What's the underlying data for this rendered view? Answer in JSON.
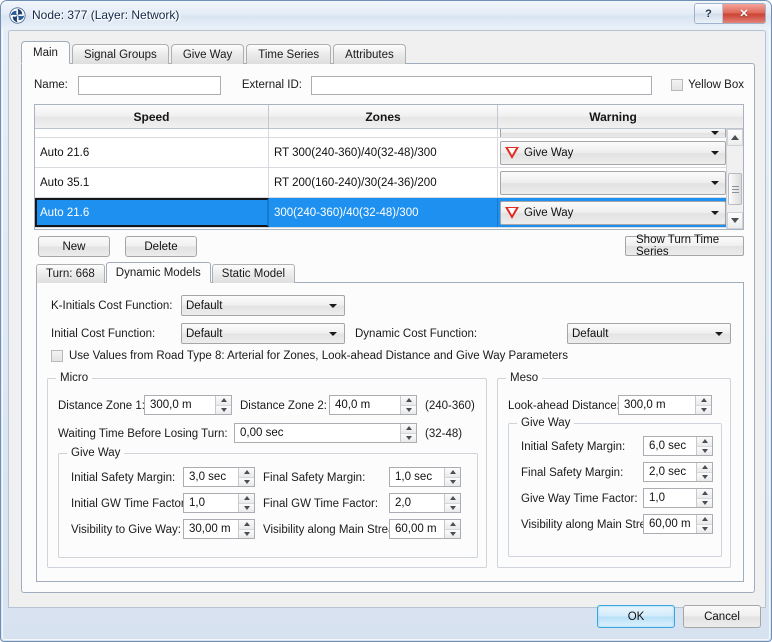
{
  "window": {
    "title": "Node: 377 (Layer: Network)",
    "app_icon": "vortex-icon",
    "help_label": "?",
    "close_label": "✕"
  },
  "main_tabs": [
    {
      "label": "Main",
      "active": true
    },
    {
      "label": "Signal Groups",
      "active": false
    },
    {
      "label": "Give Way",
      "active": false
    },
    {
      "label": "Time Series",
      "active": false
    },
    {
      "label": "Attributes",
      "active": false
    }
  ],
  "name_row": {
    "name_label": "Name:",
    "name_value": "",
    "external_id_label": "External ID:",
    "external_id_value": "",
    "yellow_box_label": "Yellow Box",
    "yellow_box_checked": false
  },
  "grid": {
    "headers": [
      "Speed",
      "Zones",
      "Warning"
    ],
    "rows": [
      {
        "speed": "",
        "zones": "",
        "warning": "",
        "warning_icon": "none",
        "partial": true,
        "selected": false
      },
      {
        "speed": "Auto 21.6",
        "zones": "RT 300(240-360)/40(32-48)/300",
        "warning": "Give Way",
        "warning_icon": "give-way-triangle",
        "partial": false,
        "selected": false
      },
      {
        "speed": "Auto 35.1",
        "zones": "RT 200(160-240)/30(24-36)/200",
        "warning": "",
        "warning_icon": "none",
        "partial": false,
        "selected": false
      },
      {
        "speed": "Auto 21.6",
        "zones": "300(240-360)/40(32-48)/300",
        "warning": "Give Way",
        "warning_icon": "give-way-triangle",
        "partial": false,
        "selected": true
      }
    ]
  },
  "buttons": {
    "new": "New",
    "delete": "Delete",
    "show_turn_time_series": "Show Turn Time Series"
  },
  "inner_tabs": [
    {
      "label": "Turn: 668",
      "active": false
    },
    {
      "label": "Dynamic Models",
      "active": true
    },
    {
      "label": "Static Model",
      "active": false
    }
  ],
  "cost_functions": {
    "k_initials_label": "K-Initials Cost Function:",
    "k_initials_value": "Default",
    "initial_label": "Initial Cost Function:",
    "initial_value": "Default",
    "dynamic_label": "Dynamic Cost Function:",
    "dynamic_value": "Default"
  },
  "road_type_checkbox": {
    "label": "Use Values from Road Type 8: Arterial for Zones, Look-ahead Distance and Give Way Parameters",
    "checked": false
  },
  "micro": {
    "title": "Micro",
    "distance_zone_1_label": "Distance Zone 1:",
    "distance_zone_1_value": "300,0 m",
    "distance_zone_2_label": "Distance Zone 2:",
    "distance_zone_2_value": "40,0 m",
    "range_1": "(240-360)",
    "waiting_time_label": "Waiting Time Before Losing Turn:",
    "waiting_time_value": "0,00 sec",
    "range_2": "(32-48)",
    "give_way": {
      "title": "Give Way",
      "initial_safety_margin_label": "Initial Safety Margin:",
      "initial_safety_margin_value": "3,0 sec",
      "final_safety_margin_label": "Final Safety Margin:",
      "final_safety_margin_value": "1,0 sec",
      "initial_gw_time_factor_label": "Initial GW Time Factor:",
      "initial_gw_time_factor_value": "1,0",
      "final_gw_time_factor_label": "Final GW Time Factor:",
      "final_gw_time_factor_value": "2,0",
      "visibility_to_give_way_label": "Visibility to Give Way:",
      "visibility_to_give_way_value": "30,00 m",
      "visibility_main_stream_label": "Visibility along Main Stream:",
      "visibility_main_stream_value": "60,00 m"
    }
  },
  "meso": {
    "title": "Meso",
    "look_ahead_label": "Look-ahead Distance:",
    "look_ahead_value": "300,0 m",
    "give_way": {
      "title": "Give Way",
      "initial_safety_margin_label": "Initial Safety Margin:",
      "initial_safety_margin_value": "6,0 sec",
      "final_safety_margin_label": "Final Safety Margin:",
      "final_safety_margin_value": "2,0 sec",
      "give_way_time_factor_label": "Give Way Time Factor:",
      "give_way_time_factor_value": "1,0",
      "visibility_main_stream_label": "Visibility along Main Stream:",
      "visibility_main_stream_value": "60,00 m"
    }
  },
  "dialog_buttons": {
    "ok": "OK",
    "cancel": "Cancel"
  },
  "colors": {
    "selection_blue": "#1e90f0",
    "warning_red": "#e03026",
    "ok_accent": "#3ba5dd",
    "close_red": "#cc4436"
  }
}
